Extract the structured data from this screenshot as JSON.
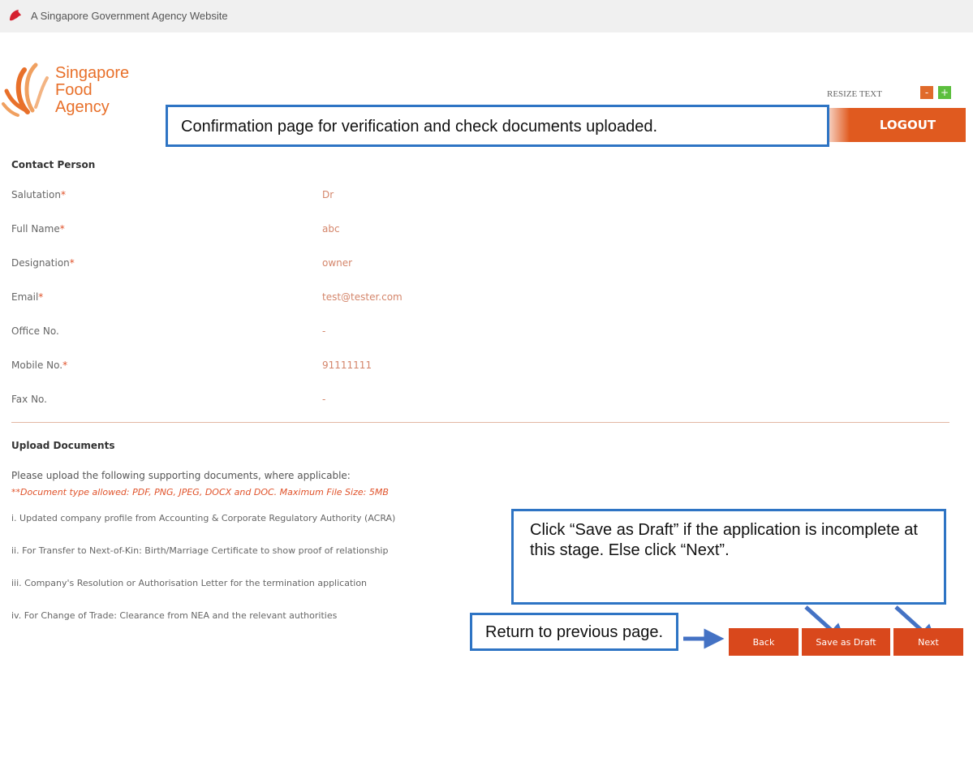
{
  "gov_bar": {
    "text": "A Singapore Government Agency Website",
    "icon": "lion-head-icon"
  },
  "logo": {
    "line1": "Singapore",
    "line2": "Food",
    "line3": "Agency"
  },
  "header": {
    "resize_label": "RESIZE TEXT",
    "minus": "-",
    "plus": "+",
    "logout_label": "LOGOUT"
  },
  "annotations": {
    "top": "Confirmation page for verification and check documents uploaded.",
    "draft": "Click “Save as Draft” if the application is incomplete at this stage. Else click “Next”.",
    "back": "Return to previous page."
  },
  "contact": {
    "title": "Contact Person",
    "fields": [
      {
        "label": "Salutation",
        "required": true,
        "value": "Dr"
      },
      {
        "label": "Full Name",
        "required": true,
        "value": "abc"
      },
      {
        "label": "Designation",
        "required": true,
        "value": "owner"
      },
      {
        "label": "Email",
        "required": true,
        "value": "test@tester.com"
      },
      {
        "label": "Office No.",
        "required": false,
        "value": "-"
      },
      {
        "label": "Mobile No.",
        "required": true,
        "value": "91111111"
      },
      {
        "label": "Fax No.",
        "required": false,
        "value": "-"
      }
    ]
  },
  "upload": {
    "title": "Upload Documents",
    "instructions": "Please upload the following supporting documents, where applicable:",
    "note": "**Document type allowed: PDF, PNG, JPEG, DOCX and DOC. Maximum File Size: 5MB",
    "items": [
      "i. Updated company profile from Accounting & Corporate Regulatory Authority (ACRA)",
      "ii. For Transfer to Next-of-Kin: Birth/Marriage Certificate to show proof of relationship",
      "iii. Company's Resolution or Authorisation Letter for the termination application",
      "iv. For Change of Trade: Clearance from NEA and the relevant authorities"
    ]
  },
  "actions": {
    "back": "Back",
    "save_draft": "Save as Draft",
    "next": "Next"
  },
  "colors": {
    "brand_orange": "#e05a1f",
    "annotation_blue": "#2e74c4",
    "value_text": "#d4856a"
  }
}
